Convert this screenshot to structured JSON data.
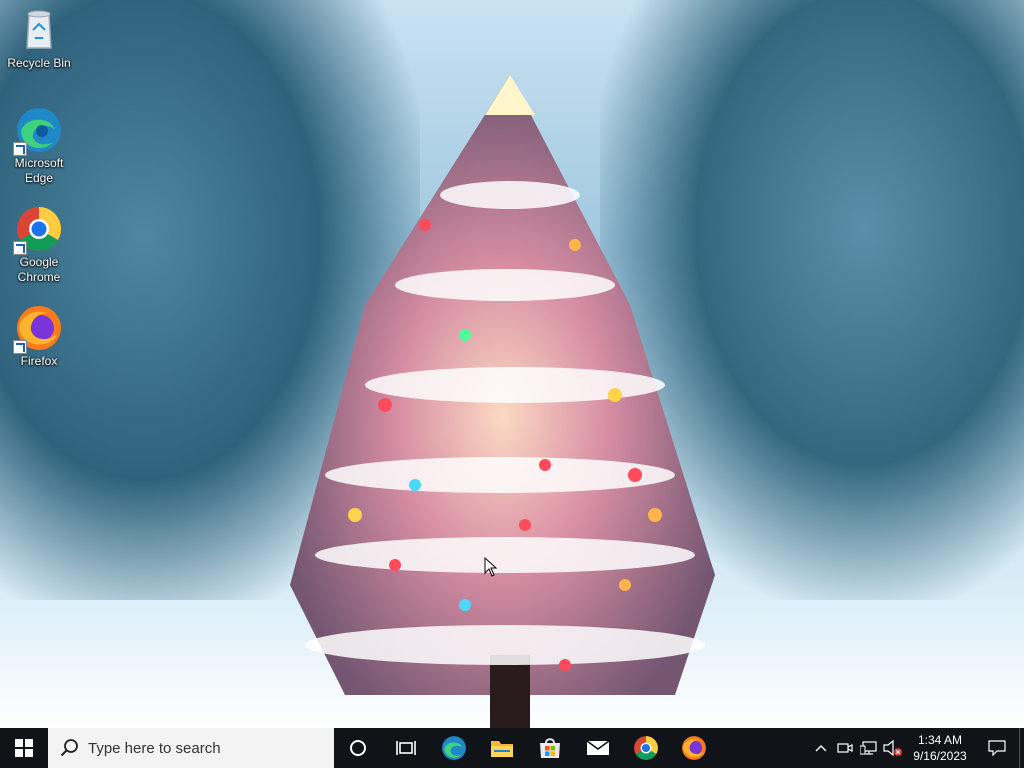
{
  "desktop": {
    "icons": [
      {
        "label": "Recycle Bin",
        "icon": "recycle-bin-icon"
      },
      {
        "label": "Microsoft Edge",
        "icon": "edge-icon"
      },
      {
        "label": "Google Chrome",
        "icon": "chrome-icon"
      },
      {
        "label": "Firefox",
        "icon": "firefox-icon"
      }
    ]
  },
  "taskbar": {
    "search_placeholder": "Type here to search",
    "pinned": [
      "cortana-icon",
      "task-view-icon",
      "edge-icon",
      "file-explorer-icon",
      "microsoft-store-icon",
      "mail-icon",
      "chrome-icon",
      "firefox-icon"
    ],
    "tray": {
      "time": "1:34 AM",
      "date": "9/16/2023"
    }
  },
  "colors": {
    "taskbar_bg": "#101418",
    "search_bg": "#f3f3f3"
  }
}
